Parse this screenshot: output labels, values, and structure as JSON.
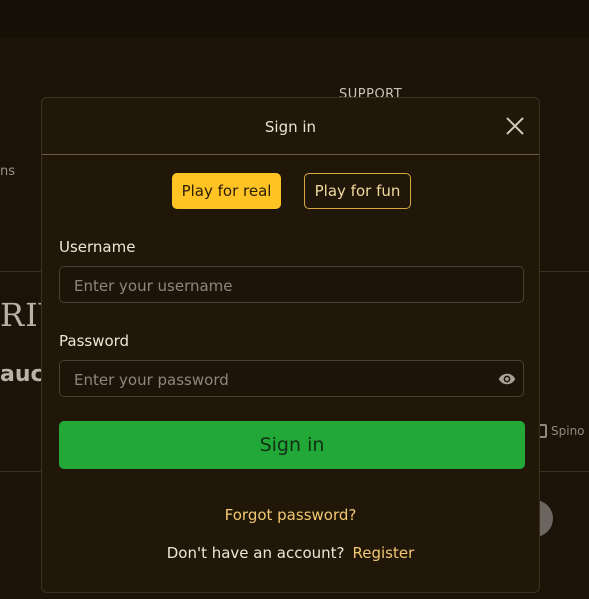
{
  "background": {
    "nav_support": "SUPPORT",
    "partial_text_left": "ns",
    "partial_logo_riv": "RIV",
    "partial_logo_auc": "auc",
    "partial_provider_spino": "Spino"
  },
  "modal": {
    "title": "Sign in",
    "close_icon": "close-icon",
    "mode_tabs": [
      {
        "label": "Play for real",
        "active": true
      },
      {
        "label": "Play for fun",
        "active": false
      }
    ],
    "username": {
      "label": "Username",
      "placeholder": "Enter your username",
      "value": ""
    },
    "password": {
      "label": "Password",
      "placeholder": "Enter your password",
      "value": "",
      "toggle_icon": "eye-icon"
    },
    "submit_label": "Sign in",
    "forgot_link": "Forgot password?",
    "no_account_text": "Don't have an account?",
    "register_link": "Register"
  },
  "colors": {
    "accent_yellow": "#ffc324",
    "success_green": "#22a836",
    "link_gold": "#f2c870",
    "modal_bg": "#201709"
  }
}
